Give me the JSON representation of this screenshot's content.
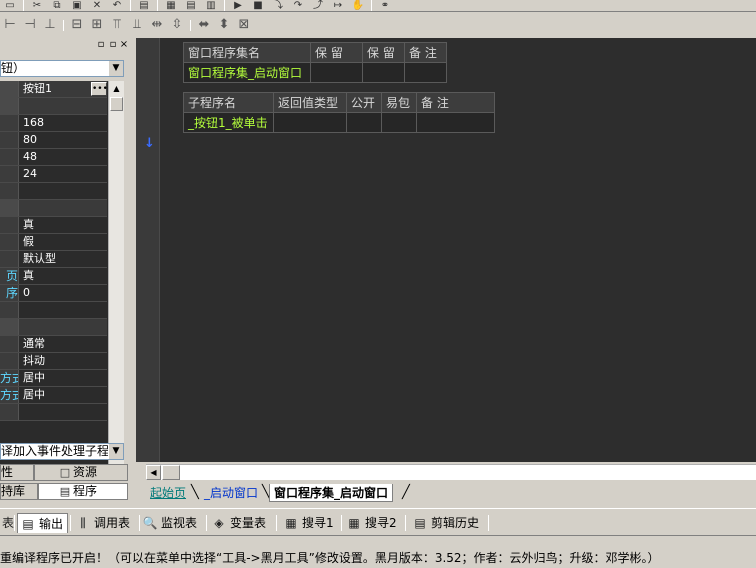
{
  "left_panel": {
    "component_select": "钮）",
    "prop_rows": [
      {
        "name": "",
        "value": "按钮1",
        "header": true,
        "ellipsis": true
      },
      {
        "name": "",
        "value": "",
        "header": true
      },
      {
        "name": "",
        "value": "168"
      },
      {
        "name": "",
        "value": "80"
      },
      {
        "name": "",
        "value": "48"
      },
      {
        "name": "",
        "value": "24"
      },
      {
        "name": "",
        "value": ""
      },
      {
        "name": "",
        "value": "",
        "header": true
      },
      {
        "name": "",
        "value": "真"
      },
      {
        "name": "",
        "value": "假"
      },
      {
        "name": "",
        "value": "默认型"
      },
      {
        "name": "页",
        "value": "真"
      },
      {
        "name": "序",
        "value": "0"
      },
      {
        "name": "",
        "value": ""
      },
      {
        "name": "",
        "value": "",
        "header": true
      },
      {
        "name": "",
        "value": "通常"
      },
      {
        "name": "",
        "value": "抖动"
      },
      {
        "name": "方式",
        "value": "居中"
      },
      {
        "name": "方式",
        "value": "居中"
      },
      {
        "name": "",
        "value": ""
      }
    ],
    "event_select": "译加入事件处理子程序",
    "tabs_row1": [
      {
        "label": "性",
        "icon": ""
      },
      {
        "label": "资源",
        "icon": "□"
      }
    ],
    "tabs_row2": [
      {
        "label": "持库",
        "icon": ""
      },
      {
        "label": "程序",
        "icon": "▤"
      }
    ],
    "close_label": "×",
    "pin_label": "▫"
  },
  "editor": {
    "assembly_table": {
      "headers": [
        "窗口程序集名",
        "保 留",
        "保 留",
        "备 注"
      ],
      "row": [
        "窗口程序集_启动窗口",
        "",
        "",
        ""
      ]
    },
    "sub_table": {
      "headers": [
        "子程序名",
        "返回值类型",
        "公开",
        "易包",
        "备 注"
      ],
      "row": [
        "_按钮1_被单击",
        "",
        "",
        "",
        ""
      ]
    },
    "gutter_marker": "↓"
  },
  "doc_tabs": [
    {
      "label": "起始页",
      "state": "teal"
    },
    {
      "label": "_启动窗口",
      "state": "inactive"
    },
    {
      "label": "窗口程序集_启动窗口",
      "state": "active"
    }
  ],
  "bottom_tabs": [
    {
      "label": "",
      "icon": "表"
    },
    {
      "label": "输出",
      "icon": "▤",
      "active": true
    },
    {
      "label": "调用表",
      "icon": "⫼"
    },
    {
      "label": "监视表",
      "icon": "🔍"
    },
    {
      "label": "变量表",
      "icon": "◈"
    },
    {
      "label": "搜寻1",
      "icon": "▦"
    },
    {
      "label": "搜寻2",
      "icon": "▦"
    },
    {
      "label": "剪辑历史",
      "icon": "▤"
    }
  ],
  "status_text": "重编译程序已开启！（可以在菜单中选择“工具->黑月工具”修改设置。黑月版本：3.52；作者：云外归鸟；升级：邓学彬。）",
  "colors": {
    "editor_bg": "#2d2d2d",
    "code_green": "#b4ff3c",
    "prop_name_cyan": "#5fd7ff",
    "tab_blue": "#0033cc"
  }
}
